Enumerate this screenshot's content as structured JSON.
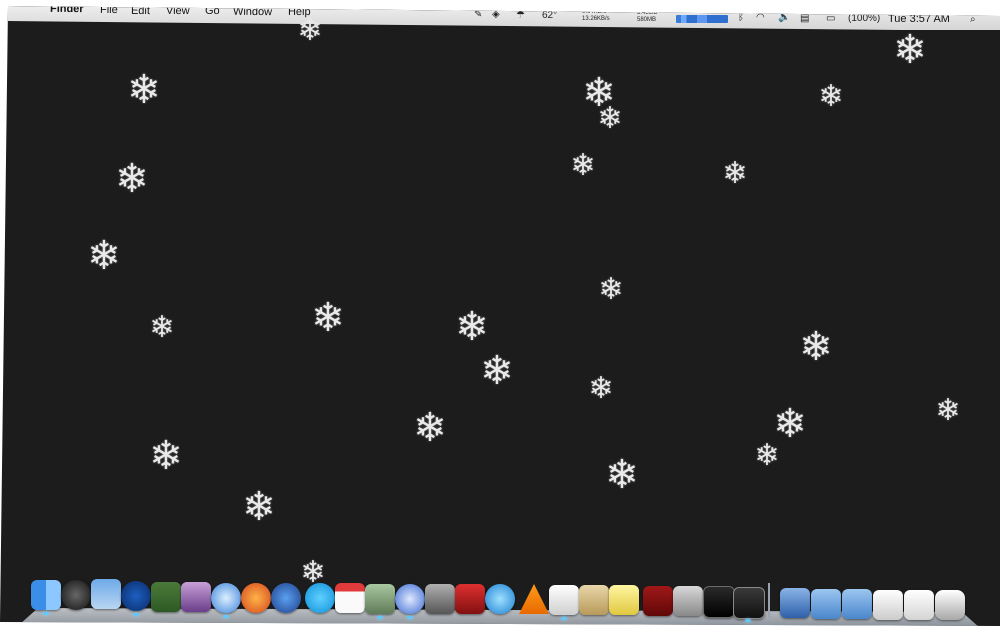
{
  "menubar": {
    "apple": "",
    "app_name": "Finder",
    "menus": [
      "File",
      "Edit",
      "View",
      "Go",
      "Window",
      "Help"
    ],
    "status": {
      "temperature": "62°",
      "net_up": "0.64KB/s",
      "net_down": "13.26KB/s",
      "mem_used": "3.43GB",
      "mem_free": "580MB",
      "battery": "(100%)",
      "clock": "Tue 3:57 AM"
    }
  },
  "desktop": {
    "background": "#1c1c1c",
    "flake_glyph": "❄"
  },
  "dock": {
    "items": [
      "finder-icon",
      "dashboard-icon",
      "mail-icon",
      "tweetie-icon",
      "preview-icon",
      "photos-icon",
      "safari-icon",
      "firefox-icon",
      "automator-icon",
      "skype-icon",
      "ical-icon",
      "iphoto-icon",
      "itunes-icon",
      "imagecapture-icon",
      "photobooth-icon",
      "quicktime-icon",
      "vlc-icon",
      "textedit-icon",
      "notes-icon",
      "stickies-icon",
      "dictionary-icon",
      "system-preferences-icon",
      "activity-monitor-icon",
      "terminal-icon",
      "downloads-stack-icon",
      "applications-folder-icon",
      "documents-folder-icon",
      "screenshots-stack-icon",
      "calendar-stack-icon",
      "trash-icon"
    ]
  }
}
